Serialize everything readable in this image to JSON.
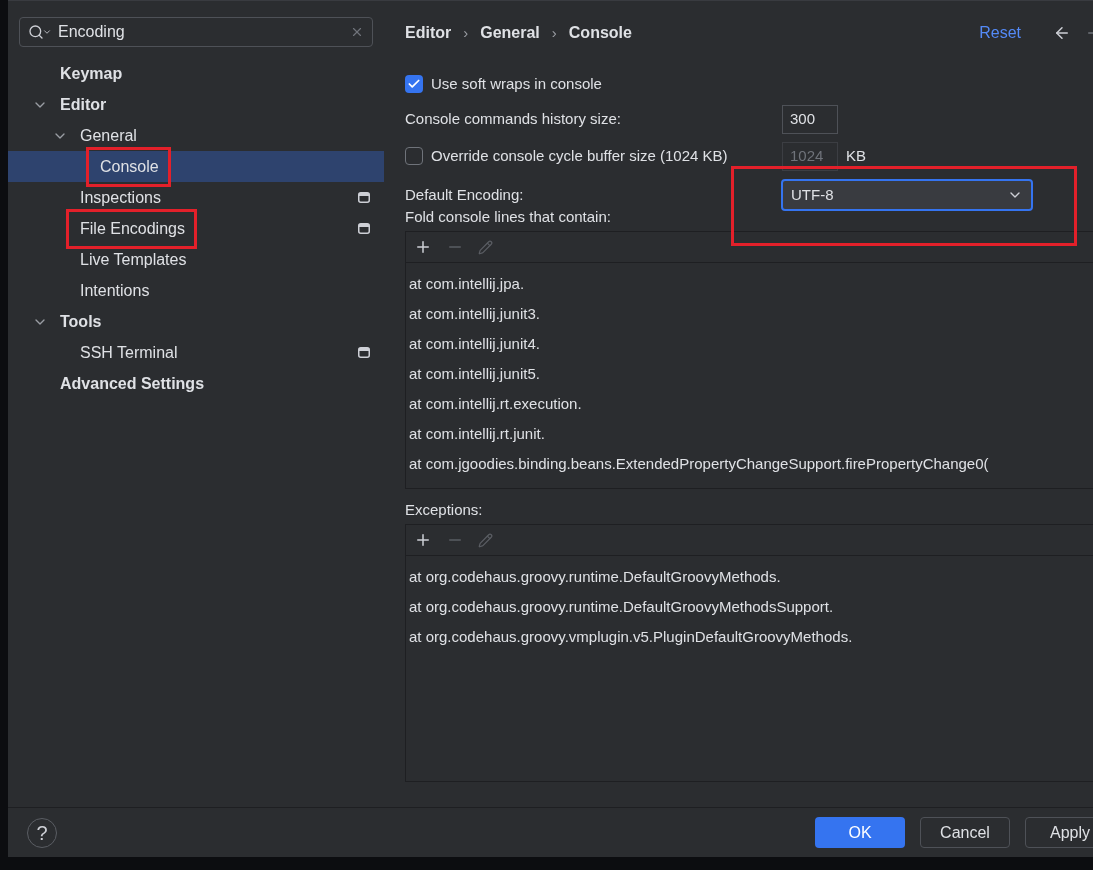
{
  "search": {
    "value": "Encoding"
  },
  "tree": [
    {
      "label": "Keymap",
      "bold": true,
      "selected": false
    },
    {
      "label": "Editor",
      "bold": true,
      "expanded": true,
      "selected": false,
      "children": [
        {
          "label": "General",
          "expanded": true,
          "selected": false,
          "children": [
            {
              "label": "Console",
              "selected": true,
              "highlighted": true
            }
          ]
        },
        {
          "label": "Inspections",
          "selected": false,
          "project_level": true
        },
        {
          "label": "File Encodings",
          "selected": false,
          "project_level": true,
          "highlighted": true
        },
        {
          "label": "Live Templates",
          "selected": false
        },
        {
          "label": "Intentions",
          "selected": false
        }
      ]
    },
    {
      "label": "Tools",
      "bold": true,
      "expanded": true,
      "selected": false,
      "children": [
        {
          "label": "SSH Terminal",
          "selected": false,
          "project_level": true
        }
      ]
    },
    {
      "label": "Advanced Settings",
      "bold": true,
      "selected": false
    }
  ],
  "breadcrumb": [
    "Editor",
    "General",
    "Console"
  ],
  "breadcrumb_separator": "›",
  "help": "?",
  "reset": "Reset",
  "settings": [
    {
      "kind": "checkbox",
      "label": "Use soft wraps in console",
      "checked": true
    },
    {
      "kind": "number",
      "label": "Console commands history size:",
      "value": "300"
    },
    {
      "kind": "checkbox_number",
      "label": "Override console cycle buffer size (1024 KB)",
      "checked": false,
      "value": "1024",
      "unit": "KB"
    },
    {
      "kind": "dropdown",
      "label": "Default Encoding:",
      "value": "UTF-8",
      "highlighted": true
    }
  ],
  "lists": [
    {
      "label": "Fold console lines that contain:",
      "items": [
        "at com.intellij.jpa.",
        "at com.intellij.junit3.",
        "at com.intellij.junit4.",
        "at com.intellij.junit5.",
        "at com.intellij.rt.execution.",
        "at com.intellij.rt.junit.",
        "at com.jgoodies.binding.beans.ExtendedPropertyChangeSupport.firePropertyChange0("
      ]
    },
    {
      "label": "Exceptions:",
      "items": [
        "at org.codehaus.groovy.runtime.DefaultGroovyMethods.",
        "at org.codehaus.groovy.runtime.DefaultGroovyMethodsSupport.",
        "at org.codehaus.groovy.vmplugin.v5.PluginDefaultGroovyMethods."
      ]
    }
  ],
  "buttons": [
    {
      "label": "OK",
      "primary": true
    },
    {
      "label": "Cancel",
      "primary": false
    },
    {
      "label": "Apply",
      "primary": false
    }
  ]
}
